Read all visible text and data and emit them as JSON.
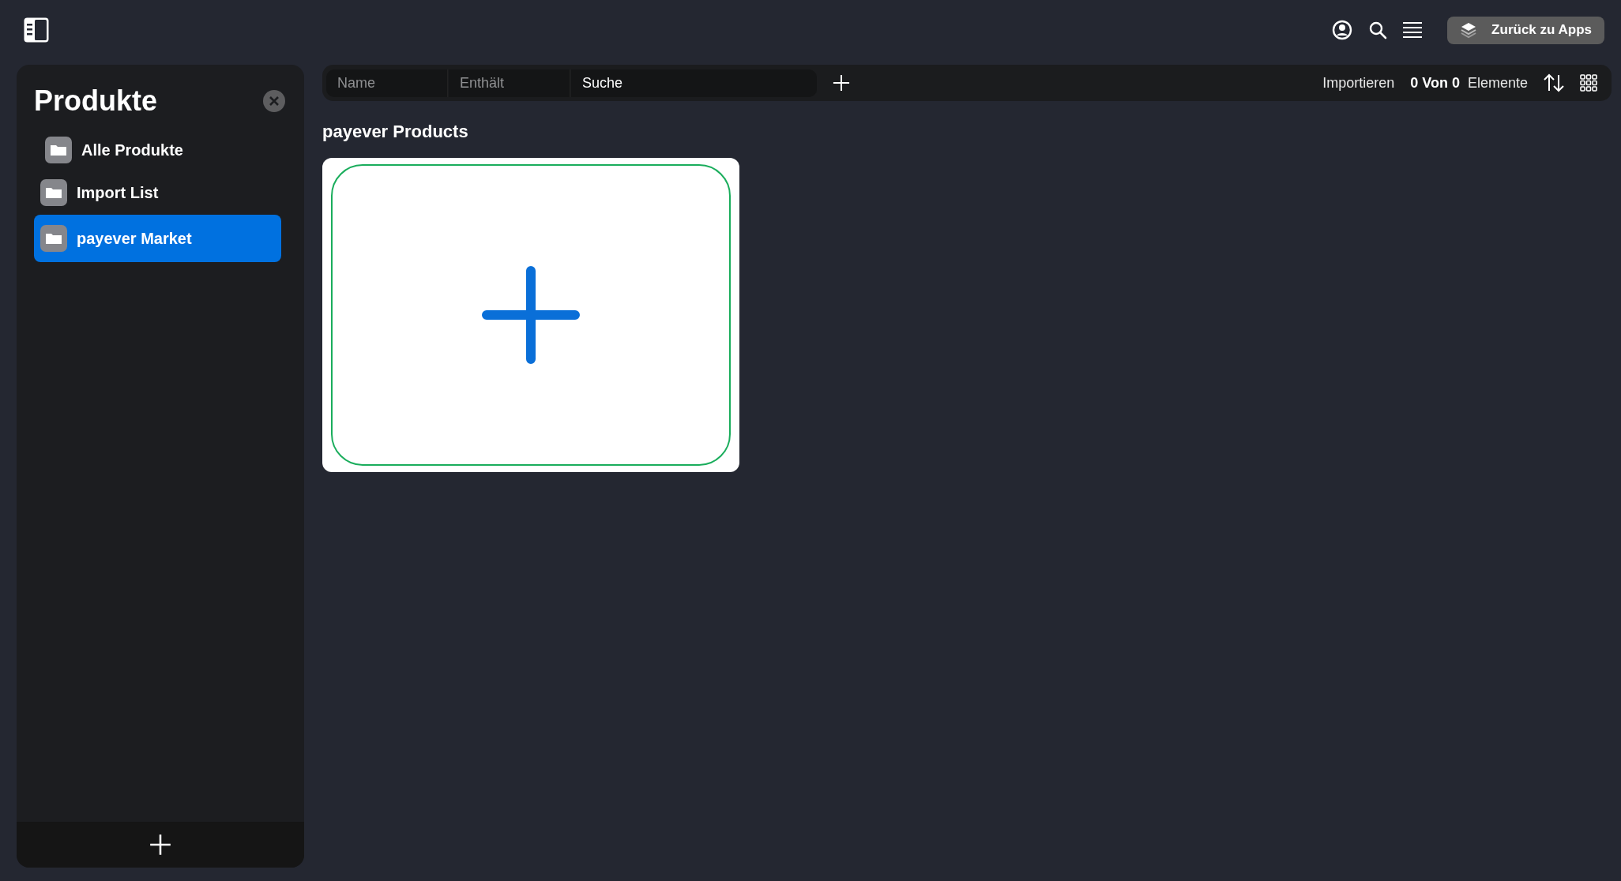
{
  "header": {
    "back_button": "Zurück zu Apps"
  },
  "sidebar": {
    "title": "Produkte",
    "items": [
      {
        "label": "Alle Produkte",
        "selected": false,
        "indented": true
      },
      {
        "label": "Import List",
        "selected": false,
        "indented": false
      },
      {
        "label": "payever Market",
        "selected": true,
        "indented": false
      }
    ]
  },
  "toolbar": {
    "filters": [
      {
        "kind": "select",
        "placeholder": "Name"
      },
      {
        "kind": "select",
        "placeholder": "Enthält"
      },
      {
        "kind": "search",
        "placeholder": "Suche"
      }
    ],
    "import_link": "Importieren",
    "count": "0 Von 0",
    "count_label": "Elemente"
  },
  "content": {
    "title": "payever Products",
    "cards": [
      {
        "kind": "add"
      }
    ]
  }
}
